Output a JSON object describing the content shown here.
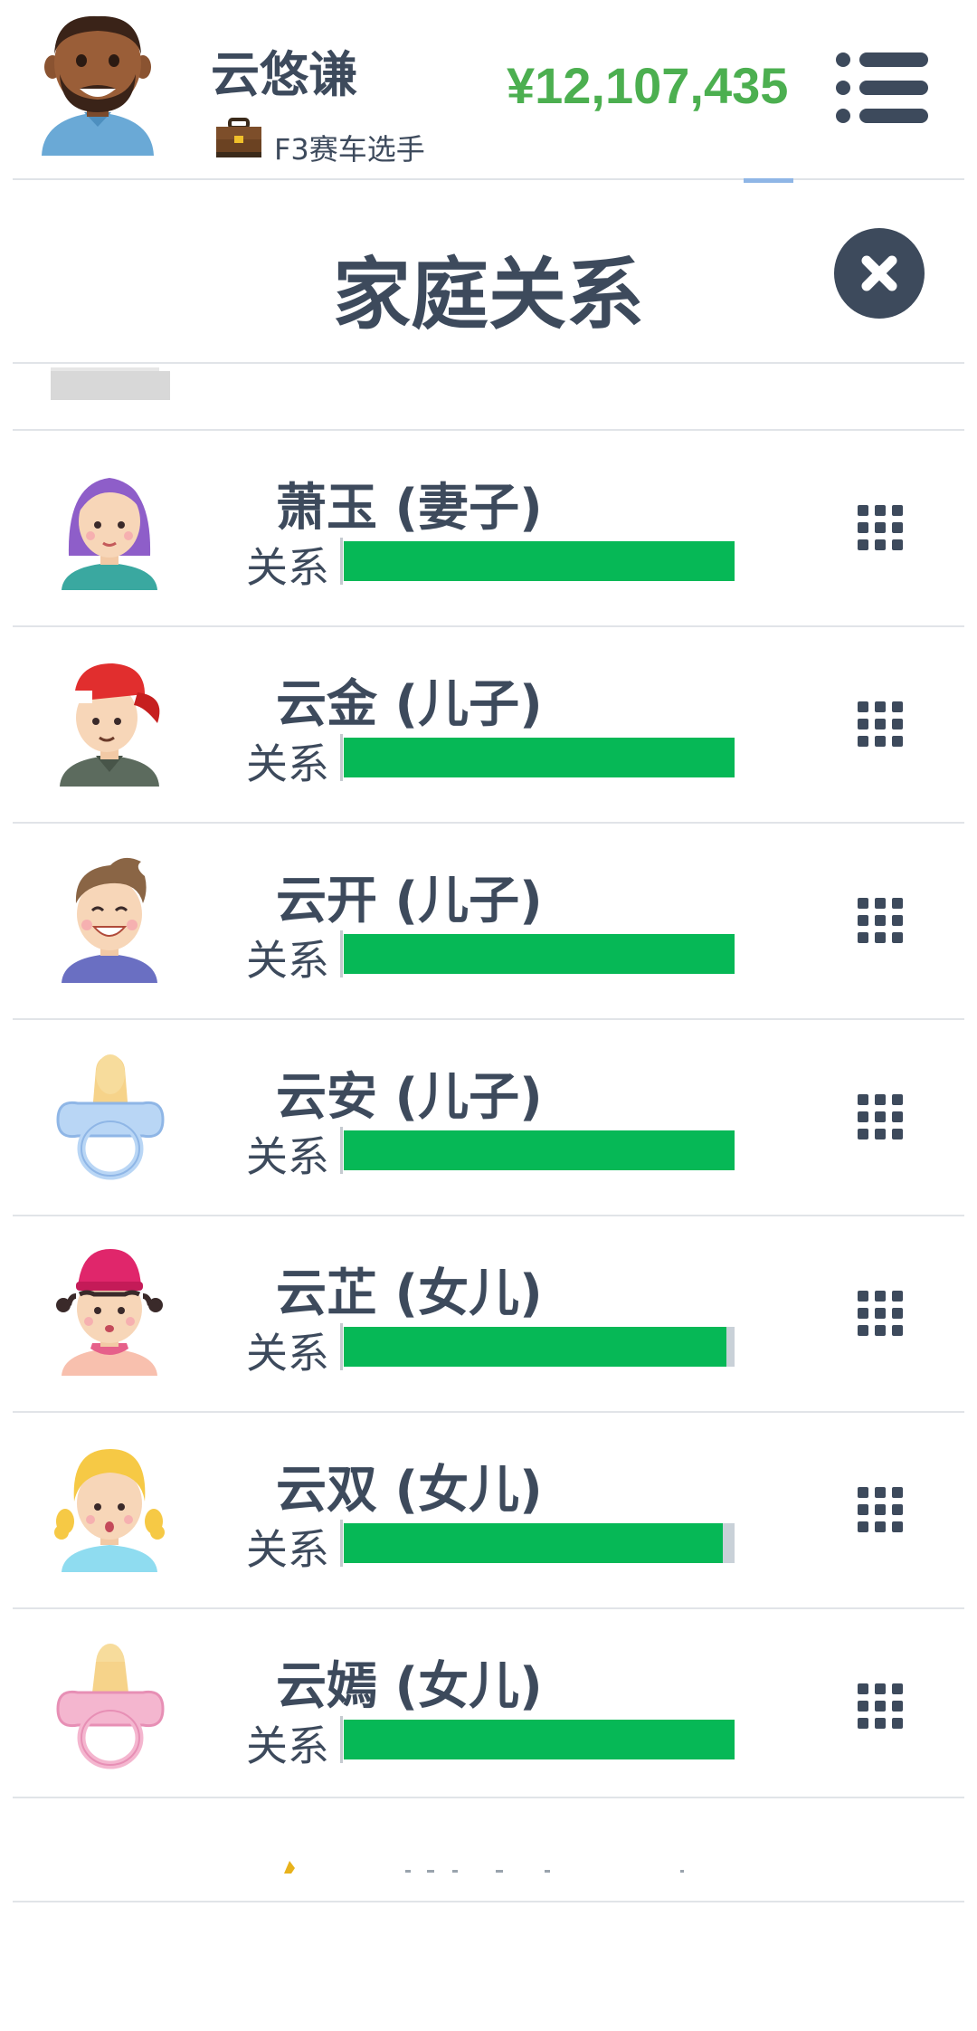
{
  "header": {
    "user_name": "云悠谦",
    "job": "F3赛车选手",
    "money": "¥12,107,435",
    "icons": {
      "avatar": "man-beard-avatar",
      "job": "briefcase-icon",
      "menu": "menu-icon"
    }
  },
  "dialog": {
    "title": "家庭关系",
    "close_icon": "close-icon"
  },
  "family": {
    "relation_label": "关系",
    "members": [
      {
        "name": "萧玉 (妻子)",
        "relationship": 1.0,
        "avatar": "woman-purple-hair-avatar"
      },
      {
        "name": "云金 (儿子)",
        "relationship": 1.0,
        "avatar": "boy-red-cap-avatar"
      },
      {
        "name": "云开 (儿子)",
        "relationship": 1.0,
        "avatar": "boy-smiling-avatar"
      },
      {
        "name": "云安 (儿子)",
        "relationship": 1.0,
        "avatar": "blue-pacifier-icon"
      },
      {
        "name": "云芷 (女儿)",
        "relationship": 0.98,
        "avatar": "girl-pink-hat-avatar"
      },
      {
        "name": "云双 (女儿)",
        "relationship": 0.97,
        "avatar": "girl-blonde-pigtails-avatar"
      },
      {
        "name": "云嫣 (女儿)",
        "relationship": 1.0,
        "avatar": "pink-pacifier-icon"
      }
    ],
    "options_icon": "grid-icon"
  },
  "colors": {
    "text": "#3d4a5c",
    "money": "#4caf50",
    "bar_fill": "#06b856",
    "bar_track": "#c9d1d8"
  }
}
